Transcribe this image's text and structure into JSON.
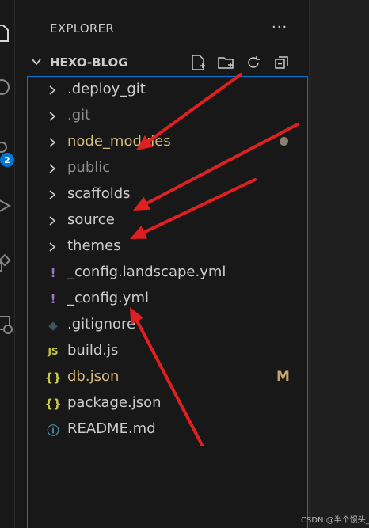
{
  "explorer": {
    "title": "EXPLORER",
    "more_label": "···"
  },
  "activity_bar": {
    "source_control_badge": "2",
    "icons": [
      "explorer-icon",
      "search-icon",
      "source-control-icon",
      "run-debug-icon",
      "extensions-icon",
      "remote-explorer-icon"
    ]
  },
  "section": {
    "title": "HEXO-BLOG",
    "actions": [
      "new-file-icon",
      "new-folder-icon",
      "refresh-icon",
      "collapse-all-icon"
    ]
  },
  "tree": [
    {
      "label": ".deploy_git",
      "kind": "folder",
      "color": "#cccccc"
    },
    {
      "label": ".git",
      "kind": "folder",
      "color": "#8c8c8c"
    },
    {
      "label": "node_modules",
      "kind": "folder",
      "color": "#d7ba7d",
      "decoration": "dot"
    },
    {
      "label": "public",
      "kind": "folder",
      "color": "#8c8c8c"
    },
    {
      "label": "scaffolds",
      "kind": "folder",
      "color": "#cccccc"
    },
    {
      "label": "source",
      "kind": "folder",
      "color": "#cccccc"
    },
    {
      "label": "themes",
      "kind": "folder",
      "color": "#cccccc"
    },
    {
      "label": "_config.landscape.yml",
      "kind": "file",
      "icon": "!",
      "icon_color": "#a074c4",
      "color": "#cccccc"
    },
    {
      "label": "_config.yml",
      "kind": "file",
      "icon": "!",
      "icon_color": "#a074c4",
      "color": "#cccccc"
    },
    {
      "label": ".gitignore",
      "kind": "file",
      "icon": "◆",
      "icon_color": "#41535b",
      "color": "#cccccc"
    },
    {
      "label": "build.js",
      "kind": "file",
      "icon": "JS",
      "icon_color": "#cbcb41",
      "color": "#cccccc"
    },
    {
      "label": "db.json",
      "kind": "file",
      "icon": "{}",
      "icon_color": "#cbcb41",
      "color": "#d7ba7d",
      "decoration": "M"
    },
    {
      "label": "package.json",
      "kind": "file",
      "icon": "{}",
      "icon_color": "#cbcb41",
      "color": "#cccccc"
    },
    {
      "label": "README.md",
      "kind": "file",
      "icon": "ⓘ",
      "icon_color": "#519aba",
      "color": "#cccccc"
    }
  ],
  "watermark": "CSDN @半个馒头_",
  "colors": {
    "accent": "#0078d4",
    "arrow": "#e02020",
    "modified": "#d7ba7d",
    "ignored": "#8c8c8c"
  }
}
